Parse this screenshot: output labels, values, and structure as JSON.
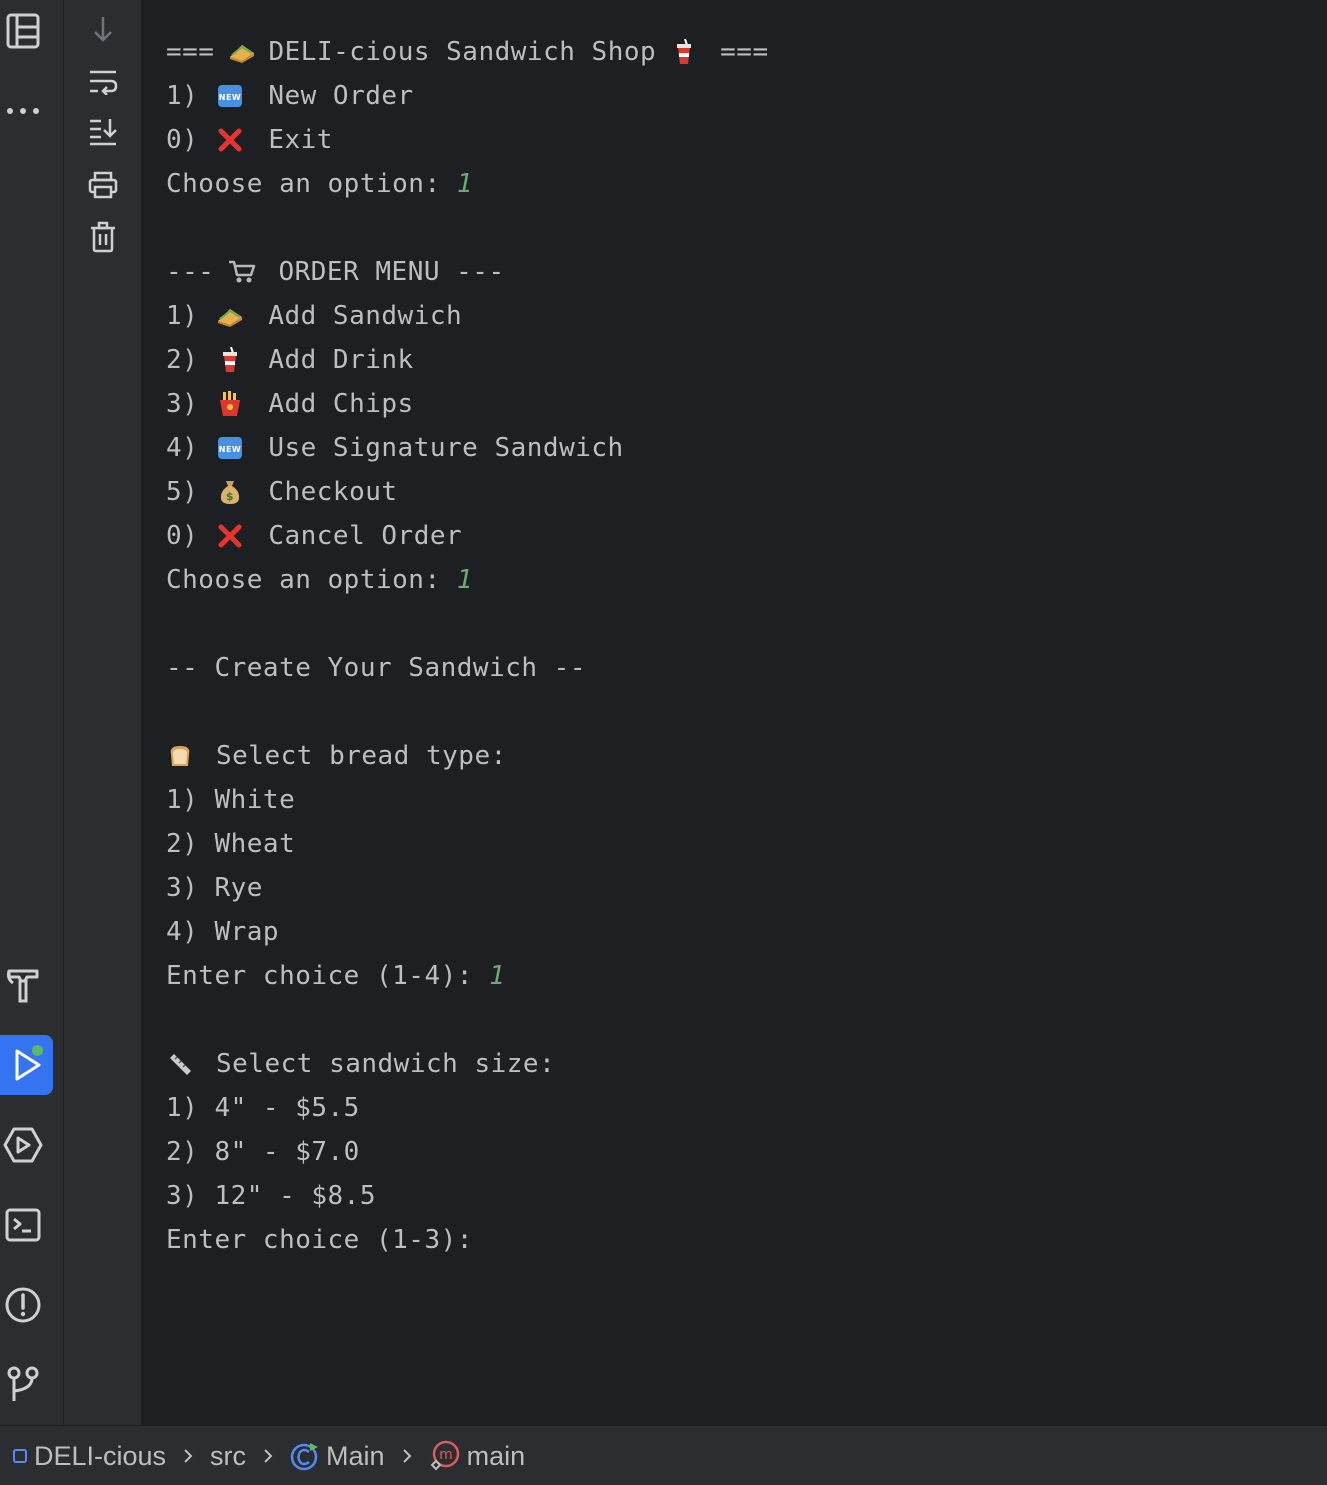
{
  "toolstripe": {
    "top_icons": [
      "project-icon",
      "more-icon"
    ],
    "bottom_icons": [
      "build-icon",
      "run-icon",
      "services-icon",
      "terminal-icon",
      "problems-icon",
      "git-icon"
    ],
    "active": "run-icon",
    "active_color": "#3574f0",
    "badge_color": "#5fb865"
  },
  "console_actions": [
    "scroll-down-icon",
    "soft-wrap-icon",
    "scroll-to-end-icon",
    "print-icon",
    "clear-icon"
  ],
  "console": {
    "text_color": "#bcbec4",
    "input_color": "#6aab73",
    "main_menu": {
      "header_left": "===",
      "header_title": "DELI-cious Sandwich Shop",
      "header_right": "===",
      "opt1_num": "1)",
      "opt1_label": "New Order",
      "opt0_num": "0)",
      "opt0_label": "Exit",
      "prompt": "Choose an option:",
      "input": "1"
    },
    "order_menu": {
      "header_left": "---",
      "header_title": "ORDER MENU ---",
      "items": [
        {
          "num": "1)",
          "icon": "sandwich-emoji",
          "label": "Add Sandwich"
        },
        {
          "num": "2)",
          "icon": "drink-emoji",
          "label": "Add Drink"
        },
        {
          "num": "3)",
          "icon": "fries-emoji",
          "label": "Add Chips"
        },
        {
          "num": "4)",
          "icon": "new-emoji",
          "label": "Use Signature Sandwich"
        },
        {
          "num": "5)",
          "icon": "money-bag-emoji",
          "label": "Checkout"
        },
        {
          "num": "0)",
          "icon": "cross-mark-emoji",
          "label": "Cancel Order"
        }
      ],
      "prompt": "Choose an option:",
      "input": "1"
    },
    "create_header": "-- Create Your Sandwich --",
    "bread": {
      "title": "Select bread type:",
      "options": [
        "1) White",
        "2) Wheat",
        "3) Rye",
        "4) Wrap"
      ],
      "prompt": "Enter choice (1-4):",
      "input": "1"
    },
    "size": {
      "title": "Select sandwich size:",
      "options": [
        "1) 4\" - $5.5",
        "2) 8\" - $7.0",
        "3) 12\" - $8.5"
      ],
      "prompt": "Enter choice (1-3):"
    }
  },
  "breadcrumb": {
    "project": "DELI-cious",
    "folder": "src",
    "class": "Main",
    "method": "main"
  }
}
